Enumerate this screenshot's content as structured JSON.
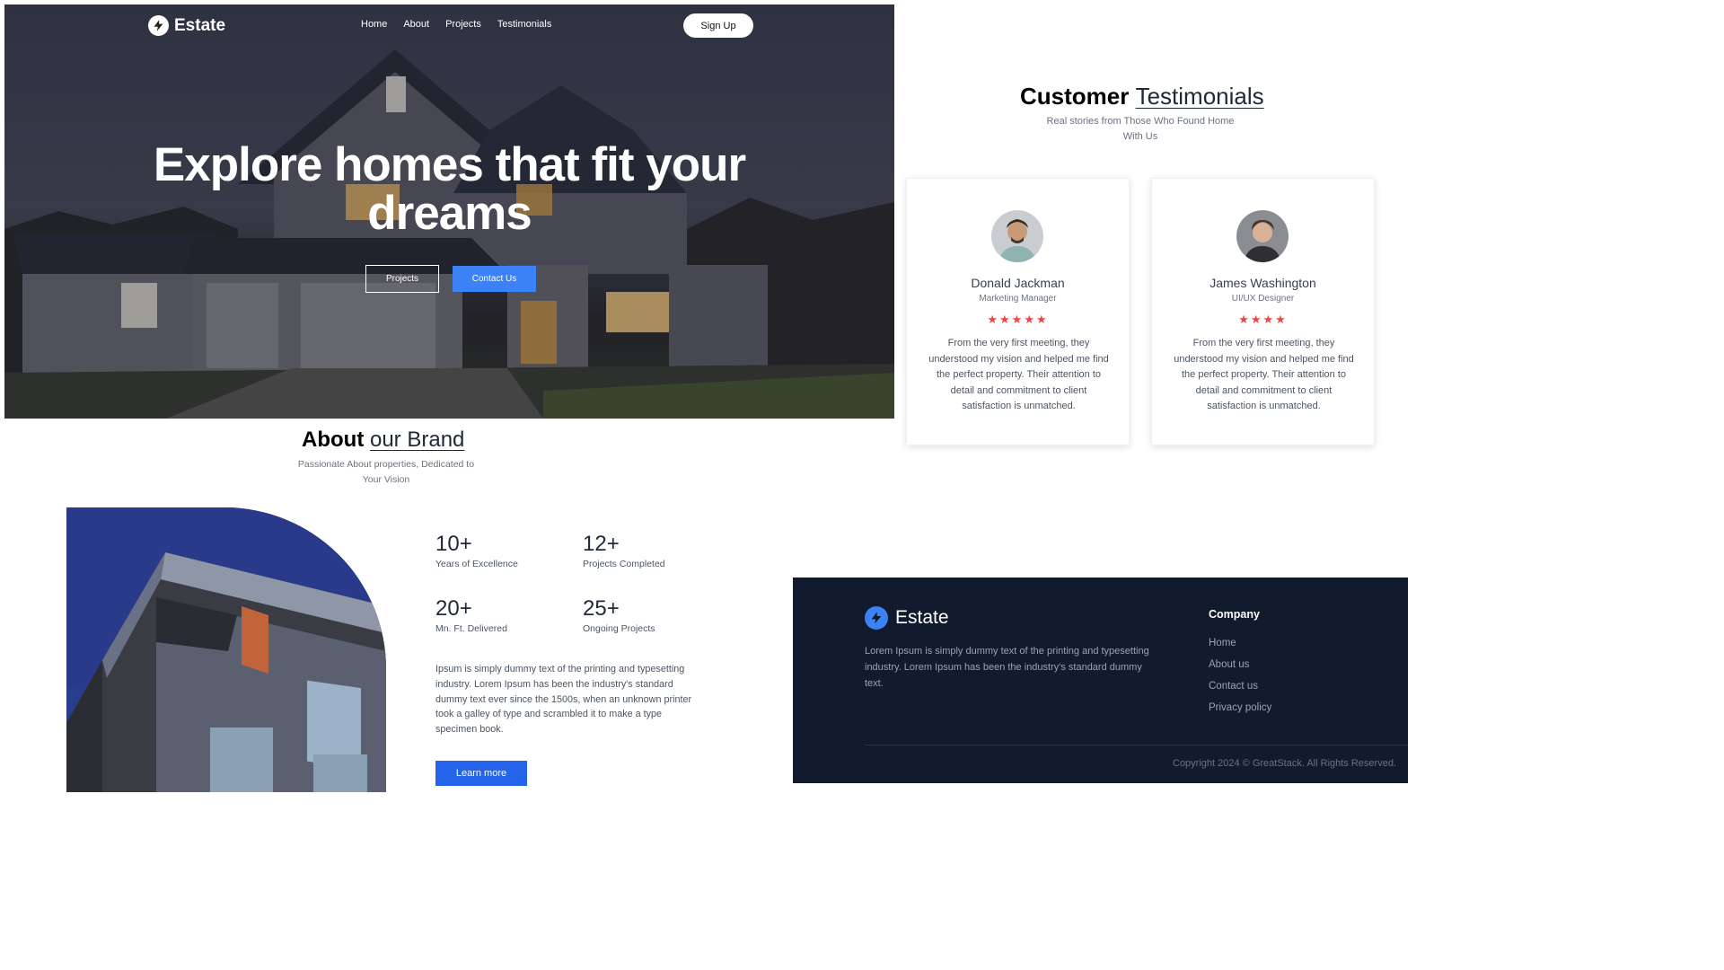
{
  "nav": {
    "brand": "Estate",
    "links": [
      "Home",
      "About",
      "Projects",
      "Testimonials"
    ],
    "signup": "Sign Up"
  },
  "hero": {
    "title": "Explore homes that fit your dreams",
    "btn_projects": "Projects",
    "btn_contact": "Contact Us"
  },
  "about": {
    "title_bold": "About",
    "title_rest": "our Brand",
    "subtitle": "Passionate About properties, Dedicated to Your Vision",
    "stats": [
      {
        "value": "10+",
        "label": "Years of Excellence"
      },
      {
        "value": "12+",
        "label": "Projects Completed"
      },
      {
        "value": "20+",
        "label": "Mn. Ft. Delivered"
      },
      {
        "value": "25+",
        "label": "Ongoing Projects"
      }
    ],
    "text": "Ipsum is simply dummy text of the printing and typesetting industry. Lorem Ipsum has been the industry's standard dummy text ever since the 1500s, when an unknown printer took a galley of type and scrambled it to make a type specimen book.",
    "button": "Learn more"
  },
  "testimonials": {
    "title_bold": "Customer",
    "title_rest": "Testimonials",
    "subtitle": "Real stories from Those Who Found Home With Us",
    "cards": [
      {
        "name": "Donald Jackman",
        "role": "Marketing Manager",
        "rating": 5,
        "stars": "★★★★★",
        "text": "From the very first meeting, they understood my vision and helped me find the perfect property. Their attention to detail and commitment to client satisfaction is unmatched."
      },
      {
        "name": "James Washington",
        "role": "UI/UX Designer",
        "rating": 4,
        "stars": "★★★★",
        "text": "From the very first meeting, they understood my vision and helped me find the perfect property. Their attention to detail and commitment to client satisfaction is unmatched."
      }
    ]
  },
  "footer": {
    "brand": "Estate",
    "description": "Lorem Ipsum is simply dummy text of the printing and typesetting industry. Lorem Ipsum has been the industry's standard dummy text.",
    "company_heading": "Company",
    "links": [
      "Home",
      "About us",
      "Contact us",
      "Privacy policy"
    ],
    "copyright": "Copyright 2024 © GreatStack. All Rights Reserved."
  },
  "colors": {
    "accent": "#3b82f6",
    "button_dark_blue": "#2563eb",
    "footer_bg": "#121a2e",
    "star": "#ef4444"
  },
  "icons": {
    "logo": "lightning-bolt-icon",
    "star": "star-icon"
  }
}
